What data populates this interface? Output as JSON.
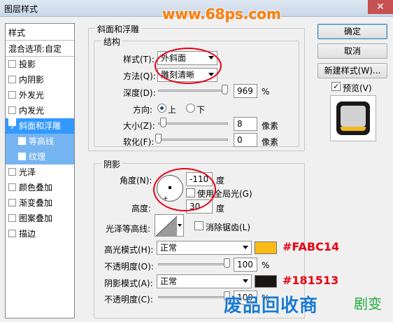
{
  "window": {
    "title": "图层样式",
    "watermark_top": "www.68ps.com",
    "close_glyph": "✕"
  },
  "left_panel": {
    "header": "样式",
    "blend_options": "混合选项:自定",
    "items": [
      {
        "label": "投影",
        "checked": false
      },
      {
        "label": "内阴影",
        "checked": false
      },
      {
        "label": "外发光",
        "checked": false
      },
      {
        "label": "内发光",
        "checked": false
      },
      {
        "label": "斜面和浮雕",
        "checked": true
      },
      {
        "label": "等高线",
        "checked": false
      },
      {
        "label": "纹理",
        "checked": false
      },
      {
        "label": "光泽",
        "checked": false
      },
      {
        "label": "颜色叠加",
        "checked": false
      },
      {
        "label": "渐变叠加",
        "checked": false
      },
      {
        "label": "图案叠加",
        "checked": false
      },
      {
        "label": "描边",
        "checked": false
      }
    ]
  },
  "bevel": {
    "section_title": "斜面和浮雕",
    "structure_title": "结构",
    "style_label": "样式(T):",
    "style_value": "外斜面",
    "technique_label": "方法(Q):",
    "technique_value": "雕刻清晰",
    "depth_label": "深度(D):",
    "depth_value": "969",
    "depth_unit": "%",
    "direction_label": "方向:",
    "direction_up": "上",
    "direction_down": "下",
    "size_label": "大小(Z):",
    "size_value": "8",
    "size_unit": "像素",
    "soften_label": "软化(F):",
    "soften_value": "0",
    "soften_unit": "像素",
    "depth_slider_level": 0.97,
    "size_slider_level": 0.04,
    "soften_slider_level": 0.0
  },
  "shading": {
    "title": "阴影",
    "angle_label": "角度(N):",
    "angle_value": "-110",
    "angle_unit": "度",
    "global_light_label": "使用全局光(G)",
    "global_light_checked": false,
    "altitude_label": "高度:",
    "altitude_value": "30",
    "altitude_unit": "度",
    "gloss_contour_label": "光泽等高线:",
    "anti_alias_label": "消除锯齿(L)",
    "highlight_mode_label": "高光模式(H):",
    "highlight_mode_value": "正常",
    "highlight_color": "#FABC14",
    "highlight_color_label": "#FABC14",
    "highlight_opacity_label": "不透明度(O):",
    "highlight_opacity_value": "100",
    "highlight_opacity_unit": "%",
    "shadow_mode_label": "阴影模式(A):",
    "shadow_mode_value": "正常",
    "shadow_color": "#181513",
    "shadow_color_label": "#181513",
    "shadow_opacity_label": "不透明度(C):",
    "shadow_opacity_value": "100",
    "shadow_opacity_unit": "%",
    "highlight_opacity_level": 1.0,
    "shadow_opacity_level": 1.0
  },
  "buttons": {
    "ok": "确定",
    "cancel": "取消",
    "new_style": "新建样式(W)...",
    "preview_label": "预览(V)",
    "preview_checked": true
  },
  "watermark_bottom": {
    "text": "废品回收商",
    "icon": "剧变"
  },
  "colors": {
    "accent": "#3399ff",
    "annotation_red": "#e60012"
  }
}
